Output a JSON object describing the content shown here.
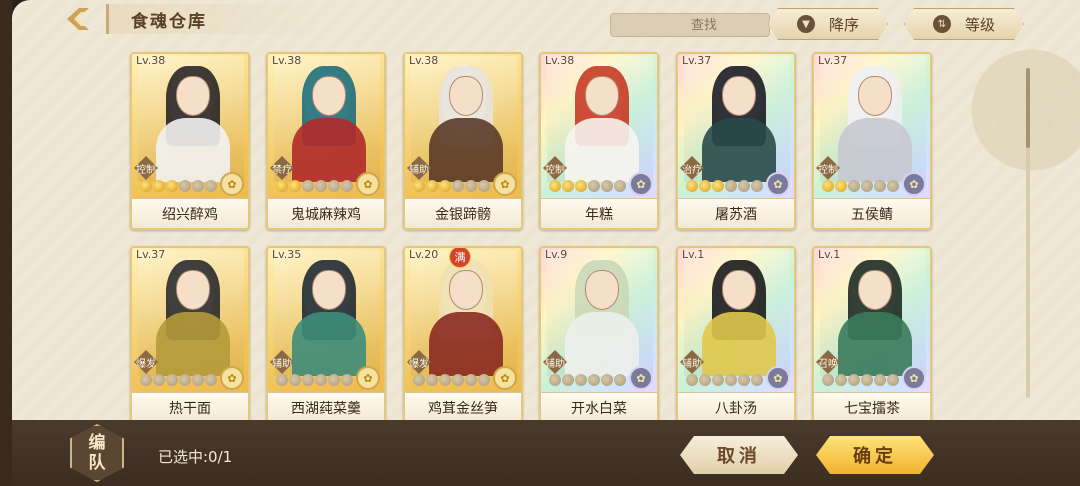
{
  "header": {
    "title": "食魂仓库",
    "search_placeholder": "查找",
    "sort_label": "降序",
    "level_label": "等级"
  },
  "cards": [
    {
      "level": "Lv.38",
      "role": "控制",
      "name": "绍兴醉鸡",
      "stars_on": 3,
      "frame": "gold",
      "hair": "#2a2522",
      "body": "#f2f2f2"
    },
    {
      "level": "Lv.38",
      "role": "禁疗",
      "name": "鬼城麻辣鸡",
      "stars_on": 2,
      "frame": "gold",
      "hair": "#1e6e7a",
      "body": "#b02a2a"
    },
    {
      "level": "Lv.38",
      "role": "辅助",
      "name": "金银蹄髈",
      "stars_on": 3,
      "frame": "gold",
      "hair": "#e8e2da",
      "body": "#5a3a28"
    },
    {
      "level": "Lv.38",
      "role": "控制",
      "name": "年糕",
      "stars_on": 3,
      "frame": "rainbow",
      "hair": "#c83a22",
      "body": "#f7f4f0"
    },
    {
      "level": "Lv.37",
      "role": "治疗",
      "name": "屠苏酒",
      "stars_on": 3,
      "frame": "rainbow",
      "hair": "#1b1b22",
      "body": "#2a4a4a"
    },
    {
      "level": "Lv.37",
      "role": "控制",
      "name": "五侯鲭",
      "stars_on": 2,
      "frame": "rainbow",
      "hair": "#efeef0",
      "body": "#c8c8d2"
    },
    {
      "level": "Lv.37",
      "role": "爆发",
      "name": "热干面",
      "stars_on": 0,
      "frame": "gold",
      "hair": "#2a2a2a",
      "body": "#b49a3a"
    },
    {
      "level": "Lv.35",
      "role": "辅助",
      "name": "西湖莼菜羹",
      "stars_on": 0,
      "frame": "gold",
      "hair": "#1f2a30",
      "body": "#3d8c7a"
    },
    {
      "level": "Lv.20",
      "role": "爆发",
      "name": "鸡茸金丝笋",
      "stars_on": 0,
      "frame": "gold",
      "hair": "#efe0b0",
      "body": "#8a2a22",
      "badge": "满"
    },
    {
      "level": "Lv.9",
      "role": "辅助",
      "name": "开水白菜",
      "stars_on": 0,
      "frame": "rainbow",
      "hair": "#c9d8b6",
      "body": "#eef0ec"
    },
    {
      "level": "Lv.1",
      "role": "辅助",
      "name": "八卦汤",
      "stars_on": 0,
      "frame": "rainbow",
      "hair": "#1a1a1a",
      "body": "#e0c84a"
    },
    {
      "level": "Lv.1",
      "role": "召唤",
      "name": "七宝擂茶",
      "stars_on": 0,
      "frame": "rainbow",
      "hair": "#1e2a22",
      "body": "#3a7a5a"
    }
  ],
  "footer": {
    "team_label_1": "编",
    "team_label_2": "队",
    "selected": "已选中:0/1",
    "cancel_label": "取消",
    "confirm_label": "确定"
  }
}
